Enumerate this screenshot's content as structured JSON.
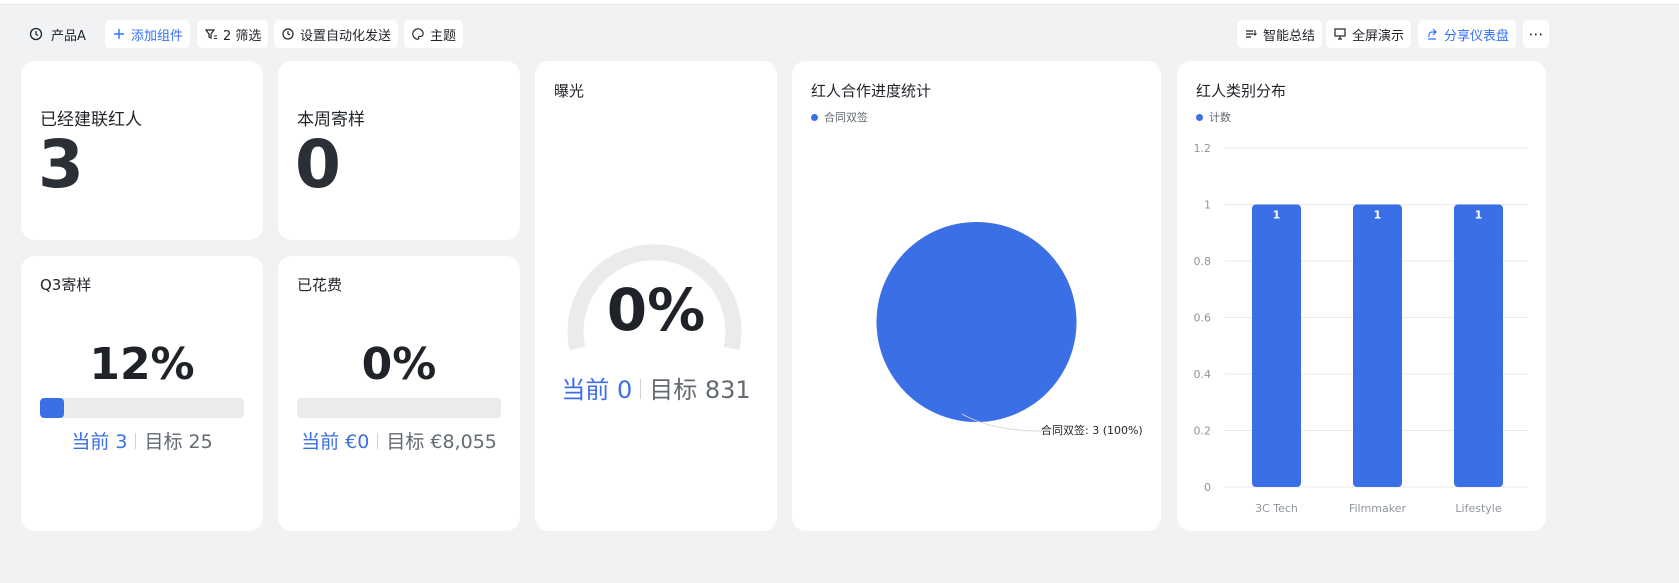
{
  "toolbar": {
    "product": "产品A",
    "add_component": "添加组件",
    "filter": "2 筛选",
    "automation": "设置自动化发送",
    "theme": "主题",
    "smart_summary": "智能总结",
    "fullscreen": "全屏演示",
    "share": "分享仪表盘",
    "more": "⋯"
  },
  "cards": {
    "contacted": {
      "title": "已经建联红人",
      "value": "3"
    },
    "weekly_samples": {
      "title": "本周寄样",
      "value": "0"
    },
    "q3_samples": {
      "title": "Q3寄样",
      "percent": "12%",
      "progress": 0.12,
      "current": "当前 3",
      "target": "目标 25"
    },
    "spent": {
      "title": "已花费",
      "percent": "0%",
      "progress": 0,
      "current": "当前 €0",
      "target": "目标 €8,055"
    },
    "exposure": {
      "title": "曝光",
      "percent": "0%",
      "progress": 0,
      "current": "当前 0",
      "target": "目标 831"
    }
  },
  "chart_data": [
    {
      "type": "pie",
      "title": "红人合作进度统计",
      "legend": [
        "合同双签"
      ],
      "legend_position": "top-left",
      "slices": [
        {
          "name": "合同双签",
          "value": 3,
          "percent": 100
        }
      ],
      "slice_label": "合同双签: 3 (100%)"
    },
    {
      "type": "bar",
      "title": "红人类别分布",
      "legend": [
        "计数"
      ],
      "legend_position": "top-left",
      "categories": [
        "3C Tech",
        "Filmmaker",
        "Lifestyle"
      ],
      "series": [
        {
          "name": "计数",
          "values": [
            1,
            1,
            1
          ]
        }
      ],
      "ylim": [
        0,
        1.2
      ],
      "yticks": [
        "0",
        "0.2",
        "0.4",
        "0.6",
        "0.8",
        "1",
        "1.2"
      ],
      "grid": true
    }
  ],
  "colors": {
    "accent": "#3b6fe5",
    "link": "#3370ff",
    "track": "#ebebeb"
  }
}
